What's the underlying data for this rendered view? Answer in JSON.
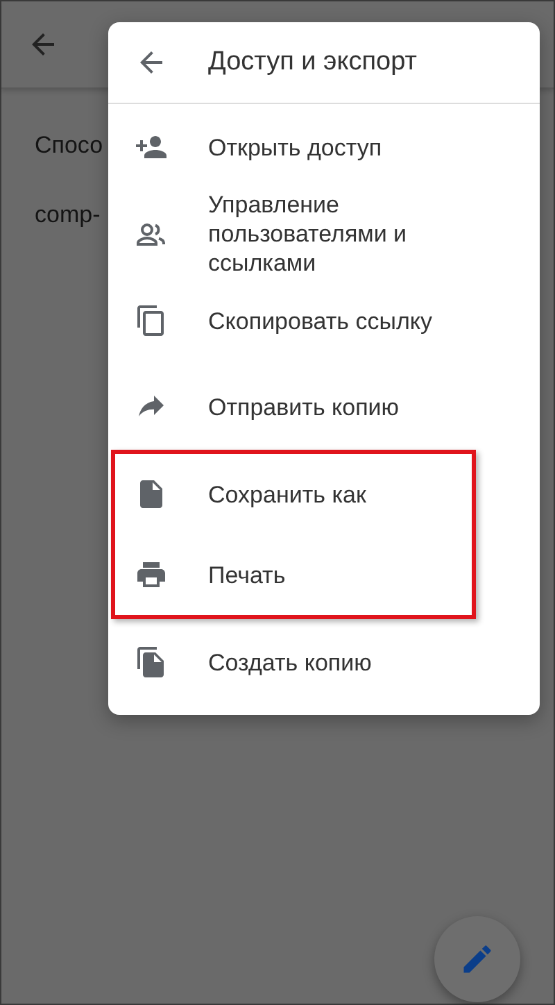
{
  "background": {
    "texts": [
      "Спосо",
      "comp-"
    ]
  },
  "menu": {
    "title": "Доступ и экспорт",
    "items": [
      {
        "label": "Открыть доступ",
        "highlighted": false
      },
      {
        "label": "Управление пользователями и ссылками",
        "highlighted": false
      },
      {
        "label": "Скопировать ссылку",
        "highlighted": false
      },
      {
        "label": "Отправить копию",
        "highlighted": false
      },
      {
        "label": "Сохранить как",
        "highlighted": true
      },
      {
        "label": "Печать",
        "highlighted": true
      },
      {
        "label": "Создать копию",
        "highlighted": false
      }
    ]
  }
}
